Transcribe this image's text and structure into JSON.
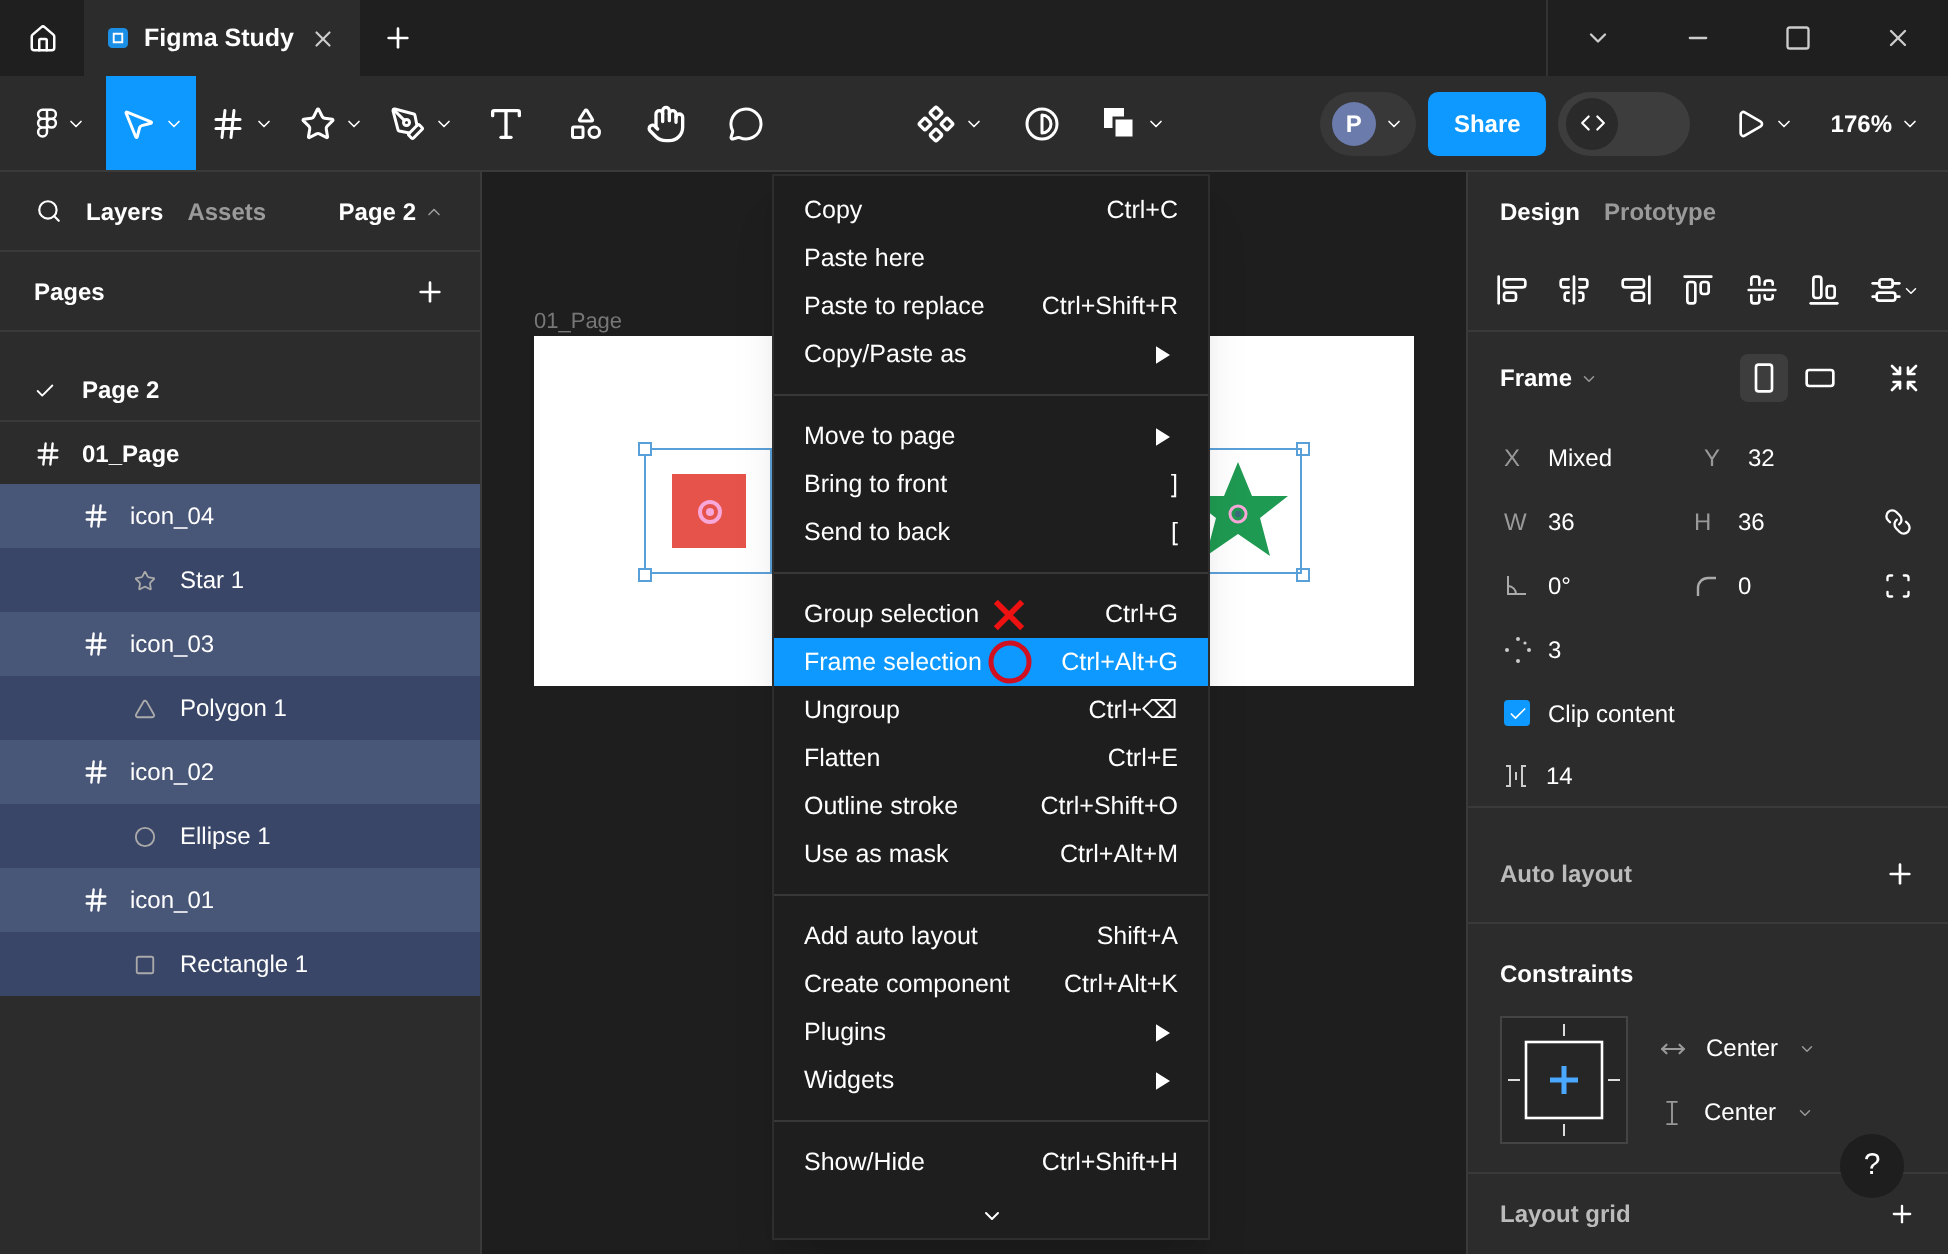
{
  "title_bar": {
    "tabs": [
      {
        "label": "Figma Study",
        "selected": true
      }
    ]
  },
  "toolbar": {
    "tools": [
      {
        "kind": "figma",
        "selected": false,
        "menu": true
      },
      {
        "kind": "move",
        "selected": true,
        "menu": true
      },
      {
        "kind": "frame",
        "selected": false,
        "menu": true
      },
      {
        "kind": "shape",
        "selected": false,
        "menu": true
      },
      {
        "kind": "pen",
        "selected": false,
        "menu": true
      },
      {
        "kind": "text",
        "selected": false,
        "menu": false
      },
      {
        "kind": "resources",
        "selected": false,
        "menu": false
      },
      {
        "kind": "hand",
        "selected": false,
        "menu": false
      },
      {
        "kind": "comment",
        "selected": false,
        "menu": false
      }
    ],
    "center_tools": [
      {
        "kind": "component",
        "menu": true
      },
      {
        "kind": "mask",
        "menu": false
      },
      {
        "kind": "boolean",
        "menu": true
      }
    ],
    "avatar": "P",
    "share": "Share",
    "dev_mode": {
      "on": false
    },
    "zoom": "176%"
  },
  "left_panel": {
    "tabs": [
      {
        "label": "Layers",
        "selected": true
      },
      {
        "label": "Assets",
        "selected": false
      }
    ],
    "page_picker": "Page 2",
    "pages_title": "Pages",
    "pages": [
      {
        "name": "Page 2",
        "selected": true
      }
    ],
    "layers": [
      {
        "name": "01_Page",
        "kind": "frame",
        "selected": false,
        "children": [
          {
            "name": "icon_04",
            "kind": "frame",
            "selected": true,
            "children": [
              {
                "name": "Star 1",
                "kind": "star",
                "selected": true
              }
            ]
          },
          {
            "name": "icon_03",
            "kind": "frame",
            "selected": true,
            "children": [
              {
                "name": "Polygon 1",
                "kind": "polygon",
                "selected": true
              }
            ]
          },
          {
            "name": "icon_02",
            "kind": "frame",
            "selected": true,
            "children": [
              {
                "name": "Ellipse 1",
                "kind": "ellipse",
                "selected": true
              }
            ]
          },
          {
            "name": "icon_01",
            "kind": "frame",
            "selected": true,
            "children": [
              {
                "name": "Rectangle 1",
                "kind": "rectangle",
                "selected": true
              }
            ]
          }
        ]
      }
    ]
  },
  "canvas": {
    "frame_label": "01_Page"
  },
  "context_menu": {
    "groups": [
      [
        {
          "label": "Copy",
          "shortcut": "Ctrl+C",
          "submenu": false,
          "selected": false
        },
        {
          "label": "Paste here",
          "submenu": false,
          "selected": false
        },
        {
          "label": "Paste to replace",
          "shortcut": "Ctrl+Shift+R",
          "submenu": false,
          "selected": false
        },
        {
          "label": "Copy/Paste as",
          "submenu": true,
          "selected": false
        }
      ],
      [
        {
          "label": "Move to page",
          "submenu": true,
          "selected": false
        },
        {
          "label": "Bring to front",
          "shortcut": "]",
          "submenu": false,
          "selected": false
        },
        {
          "label": "Send to back",
          "shortcut": "[",
          "submenu": false,
          "selected": false
        }
      ],
      [
        {
          "label": "Group selection",
          "shortcut": "Ctrl+G",
          "submenu": false,
          "selected": false,
          "annotation": {
            "kind": "cross"
          }
        },
        {
          "label": "Frame selection",
          "shortcut": "Ctrl+Alt+G",
          "submenu": false,
          "selected": true,
          "annotation": {
            "kind": "circle"
          }
        },
        {
          "label": "Ungroup",
          "shortcut": "Ctrl+⌫",
          "submenu": false,
          "selected": false
        },
        {
          "label": "Flatten",
          "shortcut": "Ctrl+E",
          "submenu": false,
          "selected": false
        },
        {
          "label": "Outline stroke",
          "shortcut": "Ctrl+Shift+O",
          "submenu": false,
          "selected": false
        },
        {
          "label": "Use as mask",
          "shortcut": "Ctrl+Alt+M",
          "submenu": false,
          "selected": false
        }
      ],
      [
        {
          "label": "Add auto layout",
          "shortcut": "Shift+A",
          "submenu": false,
          "selected": false
        },
        {
          "label": "Create component",
          "shortcut": "Ctrl+Alt+K",
          "submenu": false,
          "selected": false
        },
        {
          "label": "Plugins",
          "submenu": true,
          "selected": false
        },
        {
          "label": "Widgets",
          "submenu": true,
          "selected": false
        }
      ],
      [
        {
          "label": "Show/Hide",
          "shortcut": "Ctrl+Shift+H",
          "submenu": false,
          "selected": false
        }
      ]
    ]
  },
  "right_panel": {
    "tabs": [
      {
        "label": "Design",
        "selected": true
      },
      {
        "label": "Prototype",
        "selected": false
      }
    ],
    "frame_title": "Frame",
    "orientation": [
      {
        "kind": "portrait",
        "selected": true
      },
      {
        "kind": "landscape",
        "selected": false
      }
    ],
    "rows": [
      {
        "fields": [
          {
            "kind": "letter",
            "label": "X",
            "value": "Mixed"
          },
          {
            "kind": "letter",
            "label": "Y",
            "value": "32"
          }
        ]
      },
      {
        "fields": [
          {
            "kind": "letter",
            "label": "W",
            "value": "36"
          },
          {
            "kind": "letter",
            "label": "H",
            "value": "36"
          }
        ],
        "trailing": {
          "kind": "constrain"
        }
      },
      {
        "fields": [
          {
            "kind": "rotation",
            "value": "0°"
          },
          {
            "kind": "radius",
            "value": "0"
          }
        ],
        "trailing": {
          "kind": "corners"
        }
      },
      {
        "fields": [
          {
            "kind": "count",
            "value": "3"
          }
        ]
      }
    ],
    "clip_content": {
      "label": "Clip content",
      "checked": true
    },
    "spacing": "14",
    "auto_layout": "Auto layout",
    "constraints": {
      "title": "Constraints",
      "horizontal": "Center",
      "vertical": "Center"
    },
    "layout_grid": "Layout grid",
    "help": "?"
  }
}
